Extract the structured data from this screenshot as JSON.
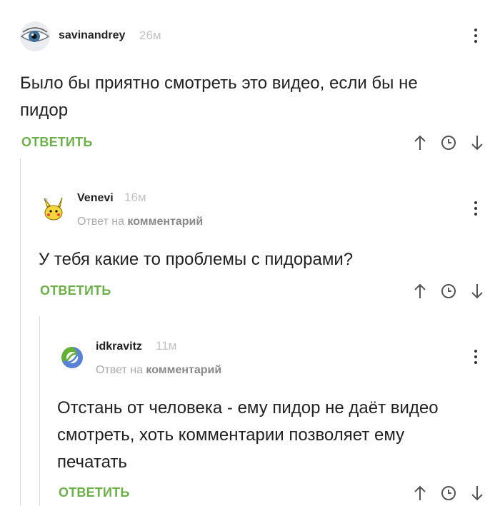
{
  "comments": [
    {
      "author": "savinandrey",
      "time": "26м",
      "text": "Было бы приятно смотреть это видео, если бы не пидор",
      "reply_label": "ОТВЕТИТЬ",
      "avatar_icon": "eye-avatar"
    },
    {
      "author": "Venevi",
      "time": "16м",
      "reply_prefix": "Ответ на",
      "reply_target": "комментарий",
      "text": "У тебя какие то проблемы с пидорами?",
      "reply_label": "ОТВЕТИТЬ",
      "avatar_icon": "pikachu-avatar"
    },
    {
      "author": "idkravitz",
      "time": "11м",
      "reply_prefix": "Ответ на",
      "reply_target": "комментарий",
      "text": "Отстань от человека - ему пидор не даёт видео смотреть, хоть комментарии позволяет ему печатать",
      "reply_label": "ОТВЕТИТЬ",
      "avatar_icon": "clojure-logo-avatar"
    }
  ],
  "colors": {
    "accent": "#6db04a",
    "muted": "#aaaaaa",
    "text": "#222222"
  }
}
